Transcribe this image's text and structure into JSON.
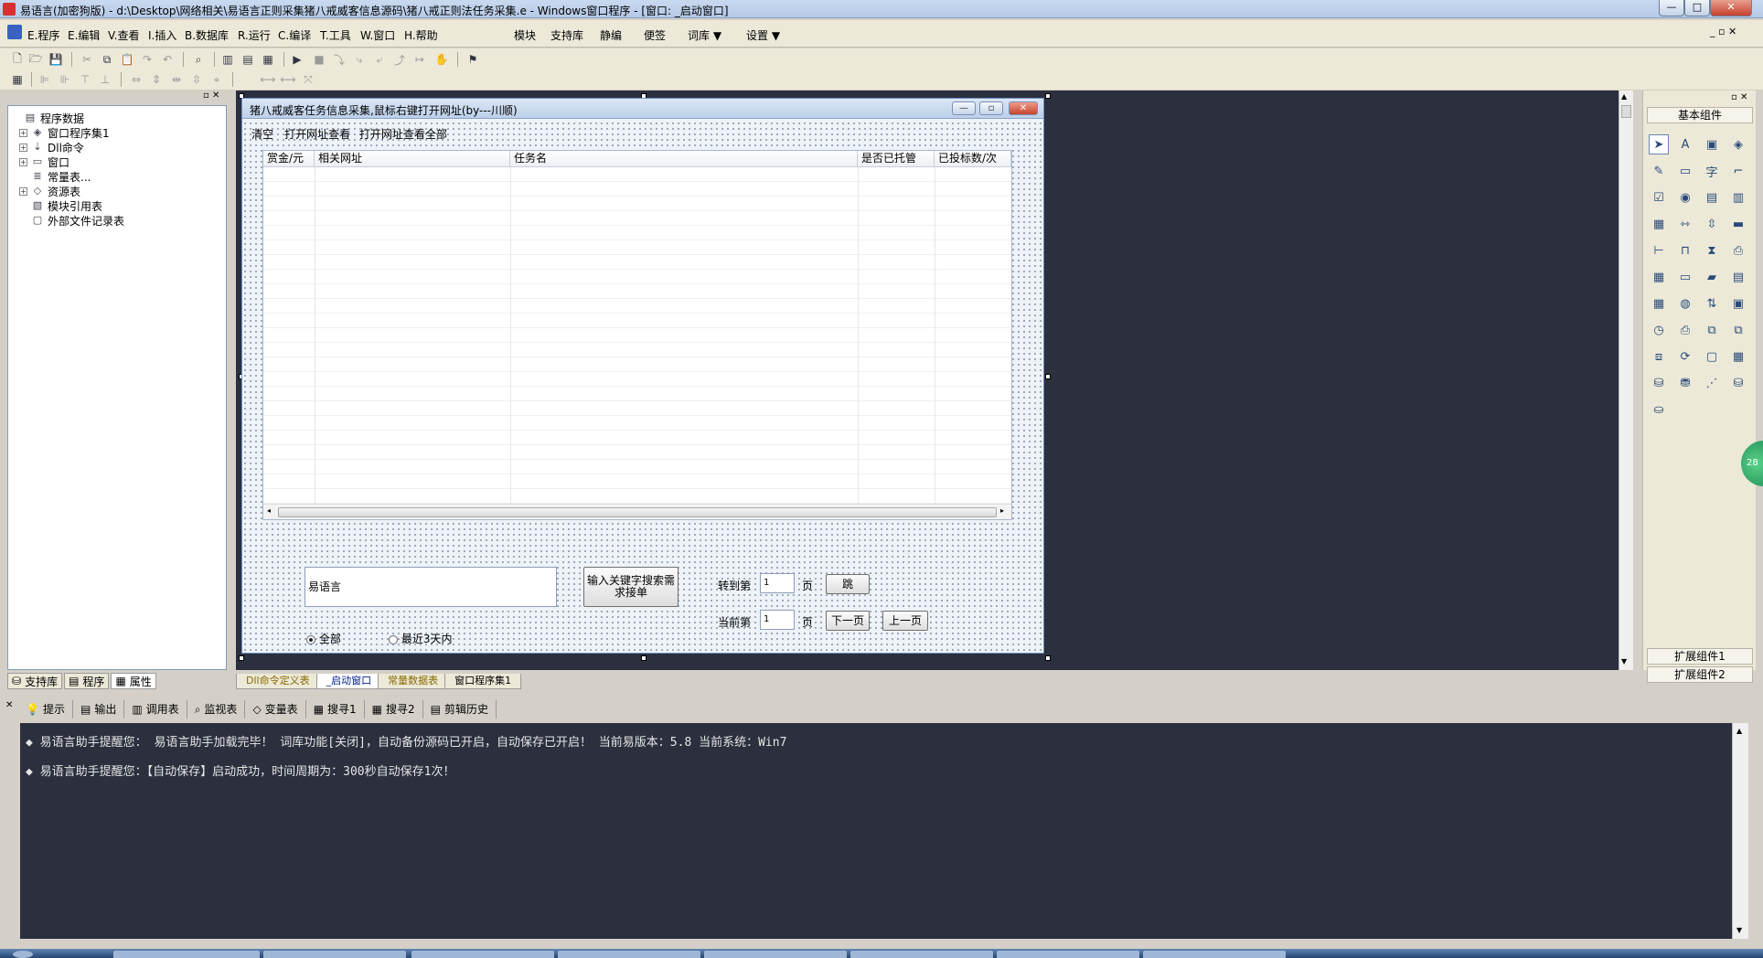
{
  "window": {
    "title": "易语言(加密狗版) - d:\\Desktop\\网络相关\\易语言正则采集猪八戒威客信息源码\\猪八戒正则法任务采集.e - Windows窗口程序 - [窗口: _启动窗口]",
    "buttons": [
      "—",
      "□",
      "✕"
    ]
  },
  "menubar": {
    "items": [
      "E.程序",
      "E.编辑",
      "V.查看",
      "I.插入",
      "B.数据库",
      "R.运行",
      "C.编译",
      "T.工具",
      "W.窗口",
      "H.帮助"
    ],
    "extras": [
      "模块",
      "支持库",
      "静编",
      "便签",
      "词库 ▼",
      "设置 ▼"
    ]
  },
  "left_panel": {
    "tree": [
      {
        "label": "程序数据",
        "expand": "",
        "icon": "▤",
        "indent": 0
      },
      {
        "label": "窗口程序集1",
        "expand": "+",
        "icon": "◈",
        "indent": 1
      },
      {
        "label": "Dll命令",
        "expand": "+",
        "icon": "⇣",
        "indent": 1
      },
      {
        "label": "窗口",
        "expand": "+",
        "icon": "▭",
        "indent": 1
      },
      {
        "label": "常量表...",
        "expand": "",
        "icon": "≣",
        "indent": 1
      },
      {
        "label": "资源表",
        "expand": "+",
        "icon": "◇",
        "indent": 1
      },
      {
        "label": "模块引用表",
        "expand": "",
        "icon": "▧",
        "indent": 1
      },
      {
        "label": "外部文件记录表",
        "expand": "",
        "icon": "▢",
        "indent": 1
      }
    ],
    "tabs": [
      "支持库",
      "程序",
      "属性"
    ]
  },
  "design_window": {
    "title": "猪八戒威客任务信息采集,鼠标右键打开网址(by---川顺)",
    "menu": [
      "清空",
      "打开网址查看",
      "打开网址查看全部"
    ],
    "list_columns": [
      "赏金/元",
      "相关网址",
      "任务名",
      "是否已托管",
      "已投标数/次"
    ],
    "keyword_input": "易语言",
    "search_button": "输入关键字搜索需求接单",
    "goto_label": "转到第",
    "goto_value": "1",
    "page_unit": "页",
    "jump_button": "跳",
    "current_label": "当前第",
    "current_value": "1",
    "next_button": "下一页",
    "prev_button": "上一页",
    "radio_all": "全部",
    "radio_recent": "最近3天内"
  },
  "right_panel": {
    "title": "基本组件",
    "ext1": "扩展组件1",
    "ext2": "扩展组件2",
    "float_badge": "28"
  },
  "editor_tabs": [
    "Dll命令定义表",
    "_启动窗口",
    "常量数据表",
    "窗口程序集1"
  ],
  "bottom_tabs": [
    "提示",
    "输出",
    "调用表",
    "监视表",
    "变量表",
    "搜寻1",
    "搜寻2",
    "剪辑历史"
  ],
  "output_lines": [
    "◆ 易语言助手提醒您： 易语言助手加载完毕！ 词库功能[关闭]，自动备份源码已开启，自动保存已开启！ 当前易版本：5.8  当前系统：Win7",
    "◆ 易语言助手提醒您：【自动保存】启动成功，时间周期为：300秒自动保存1次！"
  ],
  "colors": {
    "designer_bg": "#2b2f3e",
    "output_bg": "#2b2f3e",
    "chrome": "#ece9d8"
  }
}
